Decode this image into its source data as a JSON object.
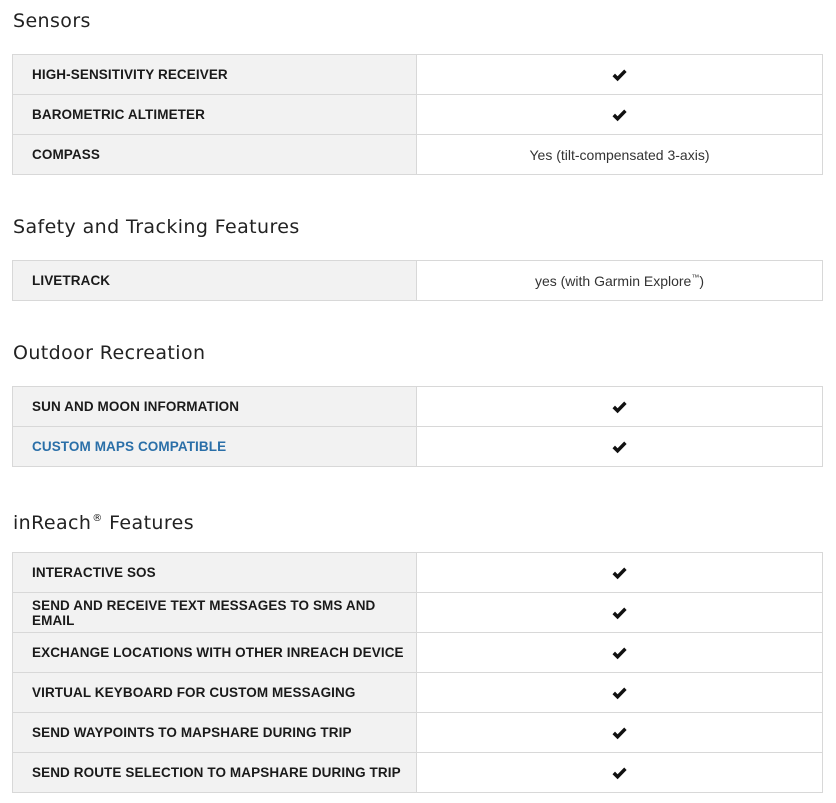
{
  "sections": [
    {
      "title": "Sensors",
      "rows": [
        {
          "label": "HIGH-SENSITIVITY RECEIVER",
          "value": "check"
        },
        {
          "label": "BAROMETRIC ALTIMETER",
          "value": "check"
        },
        {
          "label": "COMPASS",
          "value": "Yes (tilt-compensated 3-axis)"
        }
      ]
    },
    {
      "title": "Safety and Tracking Features",
      "rows": [
        {
          "label": "LIVETRACK",
          "value_text": "yes (with Garmin Explore",
          "value_sup": "™",
          "value_end": ")"
        }
      ]
    },
    {
      "title": "Outdoor Recreation",
      "rows": [
        {
          "label": "SUN AND MOON INFORMATION",
          "value": "check"
        },
        {
          "label": "CUSTOM MAPS COMPATIBLE",
          "value": "check",
          "link": true
        }
      ]
    },
    {
      "title": "inReach",
      "title_sup": "®",
      "title_end": " Features",
      "rows": [
        {
          "label": "INTERACTIVE SOS",
          "value": "check"
        },
        {
          "label": "SEND AND RECEIVE TEXT MESSAGES TO SMS AND EMAIL",
          "value": "check"
        },
        {
          "label": "EXCHANGE LOCATIONS WITH OTHER INREACH DEVICE",
          "value": "check"
        },
        {
          "label": "VIRTUAL KEYBOARD FOR CUSTOM MESSAGING",
          "value": "check"
        },
        {
          "label": "SEND WAYPOINTS TO MAPSHARE DURING TRIP",
          "value": "check"
        },
        {
          "label": "SEND ROUTE SELECTION TO MAPSHARE DURING TRIP",
          "value": "check"
        }
      ]
    }
  ],
  "icons": {
    "check": "checkmark-icon"
  },
  "colors": {
    "label_bg": "#f2f2f2",
    "link": "#2a6fa8",
    "border": "#d8d8d8"
  }
}
